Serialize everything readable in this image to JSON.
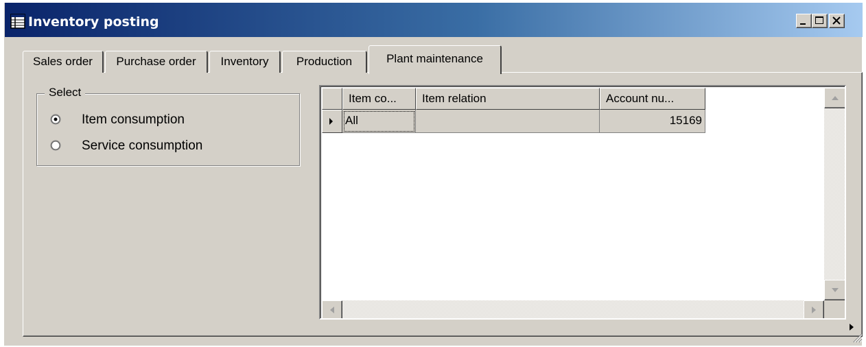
{
  "window": {
    "title": "Inventory posting",
    "icon": "form-grid-icon",
    "controls": [
      "minimize-icon",
      "maximize-icon",
      "close-icon"
    ]
  },
  "tabs": [
    {
      "label": "Sales order",
      "active": false
    },
    {
      "label": "Purchase order",
      "active": false
    },
    {
      "label": "Inventory",
      "active": false
    },
    {
      "label": "Production",
      "active": false
    },
    {
      "label": "Plant maintenance",
      "active": true
    }
  ],
  "select_group": {
    "legend": "Select",
    "options": [
      {
        "label": "Item consumption",
        "checked": true
      },
      {
        "label": "Service consumption",
        "checked": false
      }
    ]
  },
  "grid": {
    "columns": [
      "Item co...",
      "Item relation",
      "Account nu..."
    ],
    "rows": [
      {
        "item_code": "All",
        "item_relation": "",
        "account_number": "15169",
        "current": true
      }
    ]
  },
  "colors": {
    "titlebar_start": "#0a246a",
    "titlebar_end": "#a6caf0",
    "face": "#d4d0c8"
  }
}
